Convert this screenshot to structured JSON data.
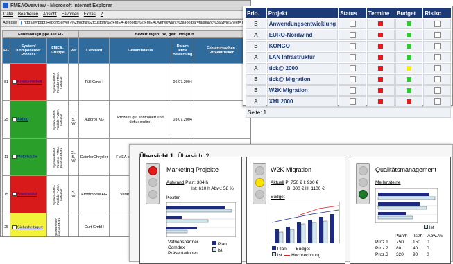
{
  "ie": {
    "title": "FMEAOverview - Microsoft Internet Explorer",
    "menu": [
      "Datei",
      "Bearbeiten",
      "Ansicht",
      "Favoriten",
      "Extras",
      "?"
    ],
    "address_label": "Adresse",
    "address": "http://wvpdpr/ReportServer?%2ffocha%2fcustom%2fFMEA-Reports%2fFMEAOverview&rc%3aToolbar=false&rc%3aStyleSheet=Trust",
    "group_header_left": "Funktionsgruppe alle FG",
    "group_header_right": "Bewertungen: rot, gelb und grün",
    "headers": [
      "FG",
      "System/ Komponente/ Prozess",
      "FMEA-Gruppe",
      "Ver",
      "Lieferant",
      "Gesamtstatus",
      "Datum letzte Bewertung",
      "Fehlerursachen / Projektrisiken"
    ],
    "rows": [
      {
        "fg": "51",
        "color": "#d91a1a",
        "system": "Kryptonfreiheit",
        "group": "System-FMEA Produkt-FMEA Lieferant",
        "ver": "",
        "supplier": "Füll GmbH",
        "status": "",
        "date": "06.07.2004",
        "risk": ""
      },
      {
        "fg": "25",
        "color": "#2aa02a",
        "system": "Airbag",
        "group": "System-FMEA Produkt-FMEA Lieferant",
        "ver": "CL, S, W",
        "supplier": "Autoroll KG",
        "status": "Prozess gut kontrolliert und dokumentiert",
        "date": "03.07.2004",
        "risk": ""
      },
      {
        "fg": "11",
        "color": "#2aa02a",
        "system": "Motorhaube",
        "group": "System-FMEA Prozess-FMEA Produkt-FMEA",
        "ver": "CL, S, W",
        "supplier": "DaimlerChrysler",
        "status": "FMEA durchgeführt, Prozess",
        "date": "",
        "risk": ""
      },
      {
        "fg": "15",
        "color": "#d91a1a",
        "system": "Frontmodul",
        "group": "System-FMEA Produkt-FMEA Lieferant",
        "ver": "S, W",
        "supplier": "Frontmodul AG",
        "status": "Verantwortliche Termine",
        "date": "",
        "risk": ""
      },
      {
        "fg": "25",
        "color": "#f2f23a",
        "system": "Sicherheitsgurt",
        "group": "System-FMEA Produkt-FMEA",
        "ver": "",
        "supplier": "Gurt GmbH",
        "status": "Kein",
        "date": "",
        "risk": ""
      }
    ]
  },
  "status": {
    "headers": [
      "Prio.",
      "Projekt",
      "Status",
      "Termine",
      "Budget",
      "Risiko"
    ],
    "rows": [
      {
        "prio": "B",
        "project": "Anwendungsentwicklung",
        "termine": "#e31b1b",
        "budget": "#2ecc2e"
      },
      {
        "prio": "A",
        "project": "EURO-Nordwind",
        "termine": "#e31b1b",
        "budget": "#2ecc2e"
      },
      {
        "prio": "B",
        "project": "KONGO",
        "termine": "#e31b1b",
        "budget": "#2ecc2e"
      },
      {
        "prio": "A",
        "project": "LAN Infrastruktur",
        "termine": "#e31b1b",
        "budget": "#2ecc2e"
      },
      {
        "prio": "A",
        "project": "tick@ 2000",
        "termine": "#e31b1b",
        "budget": "#f2f200"
      },
      {
        "prio": "B",
        "project": "tick@ Migration",
        "termine": "#e31b1b",
        "budget": "#2ecc2e"
      },
      {
        "prio": "B",
        "project": "W2K Migration",
        "termine": "#e31b1b",
        "budget": "#2ecc2e"
      },
      {
        "prio": "A",
        "project": "XML2000",
        "termine": "#e31b1b",
        "budget": "#e31b1b"
      }
    ],
    "footer": "Seite: 1"
  },
  "overview": {
    "tab_active": "Übersicht 1",
    "tab_other": "Übersicht 2",
    "marketing": {
      "title": "Marketing Projekte",
      "aufwand_label": "Aufwand",
      "plan": "Plan: 384 h",
      "ist": "Ist: 610 h",
      "abw": "Abw.: 58 %",
      "kosten_label": "Kosten",
      "items": [
        "Vetriebspartner",
        "Comdex",
        "Präsentationen"
      ],
      "legend": [
        "Plan",
        "Ist"
      ]
    },
    "w2k": {
      "title": "W2K Migration",
      "aktuell_label": "Aktuell",
      "p": "P: 750 €",
      "i": "I: 930 €",
      "b": "B: 800 €",
      "h": "H: 1100 €",
      "budget_label": "Budget",
      "legend": [
        "Plan",
        "Budget",
        "Ist",
        "Hochrechnung"
      ]
    },
    "quality": {
      "title": "Qualitätsmanagement",
      "meilensteine_label": "Meilensteine",
      "legend_ist": "Ist",
      "table_headers": [
        "Plan/h",
        "Ist/h",
        "Abw./%"
      ],
      "table_rows": [
        [
          "Proz.1",
          "750",
          "150",
          "0"
        ],
        [
          "Proz.2",
          "80",
          "40",
          "0"
        ],
        [
          "Proz.3",
          "320",
          "90",
          "0"
        ]
      ]
    }
  }
}
